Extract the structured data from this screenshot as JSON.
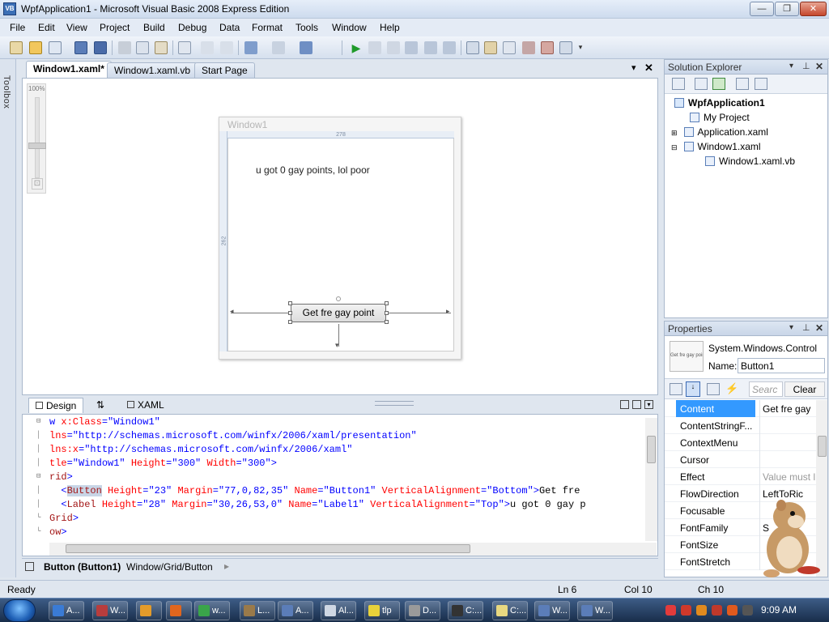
{
  "window": {
    "title": "WpfApplication1 - Microsoft Visual Basic 2008 Express Edition",
    "app_icon": "VB",
    "min_icon": "minimize-icon",
    "max_icon": "maximize-icon",
    "close_icon": "close-icon",
    "min_glyph": "—",
    "max_glyph": "❐",
    "close_glyph": "✕"
  },
  "menu": [
    "File",
    "Edit",
    "View",
    "Project",
    "Build",
    "Debug",
    "Data",
    "Format",
    "Tools",
    "Window",
    "Help"
  ],
  "toolbox": {
    "label": "Toolbox"
  },
  "doc_tabs": {
    "tabs": [
      "Window1.xaml*",
      "Window1.xaml.vb",
      "Start Page"
    ],
    "close_glyph": "✕",
    "dropdown_glyph": "▾"
  },
  "designer": {
    "zoom": "100%",
    "window_title": "Window1",
    "ruler_width": "278",
    "ruler_height": "262",
    "label_text": "u got 0 gay points, lol poor",
    "button_text": "Get fre gay point"
  },
  "view_tabs": {
    "design": "Design",
    "swap": "⇅",
    "xaml": "XAML"
  },
  "xaml_lines": [
    [
      {
        "t": "w ",
        "c": "pu"
      },
      {
        "t": "x:Class",
        "c": "at"
      },
      {
        "t": "=\"Window1\"",
        "c": "st"
      }
    ],
    [
      {
        "t": "lns",
        "c": "at"
      },
      {
        "t": "=\"http://schemas.microsoft.com/winfx/2006/xaml/presentation\"",
        "c": "st"
      }
    ],
    [
      {
        "t": "lns:x",
        "c": "at"
      },
      {
        "t": "=\"http://schemas.microsoft.com/winfx/2006/xaml\"",
        "c": "st"
      }
    ],
    [
      {
        "t": "tle",
        "c": "at"
      },
      {
        "t": "=\"Window1\"",
        "c": "st"
      },
      {
        "t": " Height",
        "c": "at"
      },
      {
        "t": "=\"300\"",
        "c": "st"
      },
      {
        "t": " Width",
        "c": "at"
      },
      {
        "t": "=\"300\">",
        "c": "st"
      }
    ],
    [
      {
        "t": "rid",
        "c": "kw"
      },
      {
        "t": ">",
        "c": "pu"
      }
    ],
    [
      {
        "t": "  <",
        "c": "pu"
      },
      {
        "t": "Button",
        "c": "kw"
      },
      {
        "t": " Height",
        "c": "at"
      },
      {
        "t": "=\"23\"",
        "c": "st"
      },
      {
        "t": " Margin",
        "c": "at"
      },
      {
        "t": "=\"77,0,82,35\"",
        "c": "st"
      },
      {
        "t": " Name",
        "c": "at"
      },
      {
        "t": "=\"Button1\"",
        "c": "st"
      },
      {
        "t": " VerticalAlignment",
        "c": "at"
      },
      {
        "t": "=\"Bottom\">",
        "c": "st"
      },
      {
        "t": "Get fre",
        "c": ""
      }
    ],
    [
      {
        "t": "  <",
        "c": "pu"
      },
      {
        "t": "Label",
        "c": "kw"
      },
      {
        "t": " Height",
        "c": "at"
      },
      {
        "t": "=\"28\"",
        "c": "st"
      },
      {
        "t": " Margin",
        "c": "at"
      },
      {
        "t": "=\"30,26,53,0\"",
        "c": "st"
      },
      {
        "t": " Name",
        "c": "at"
      },
      {
        "t": "=\"Label1\"",
        "c": "st"
      },
      {
        "t": " VerticalAlignment",
        "c": "at"
      },
      {
        "t": "=\"Top\">",
        "c": "st"
      },
      {
        "t": "u got 0 gay p",
        "c": ""
      }
    ],
    [
      {
        "t": "Grid",
        "c": "kw"
      },
      {
        "t": ">",
        "c": "pu"
      }
    ],
    [
      {
        "t": "ow",
        "c": "kw"
      },
      {
        "t": ">",
        "c": "pu"
      }
    ]
  ],
  "breadcrumb": {
    "element": "Button (Button1)",
    "path": "Window/Grid/Button"
  },
  "solution_explorer": {
    "title": "Solution Explorer",
    "items": [
      "WpfApplication1",
      "My Project",
      "Application.xaml",
      "Window1.xaml",
      "Window1.xaml.vb"
    ]
  },
  "properties": {
    "title": "Properties",
    "type": "System.Windows.Control",
    "name_label": "Name:",
    "name_value": "Button1",
    "search_placeholder": "Searc",
    "clear": "Clear",
    "preview": "Get fre gay point",
    "rows": [
      {
        "name": "Content",
        "value": "Get fre gay"
      },
      {
        "name": "ContentStringF...",
        "value": ""
      },
      {
        "name": "ContextMenu",
        "value": ""
      },
      {
        "name": "Cursor",
        "value": ""
      },
      {
        "name": "Effect",
        "value": "Value must l"
      },
      {
        "name": "FlowDirection",
        "value": "LeftToRic"
      },
      {
        "name": "Focusable",
        "value": ""
      },
      {
        "name": "FontFamily",
        "value": "S"
      },
      {
        "name": "FontSize",
        "value": ""
      },
      {
        "name": "FontStretch",
        "value": ""
      }
    ]
  },
  "status": {
    "state": "Ready",
    "ln": "Ln 6",
    "col": "Col 10",
    "ch": "Ch 10"
  },
  "taskbar": {
    "items": [
      "A...",
      "W...",
      "",
      "",
      "w...",
      "L...",
      "A...",
      "Al...",
      "tlp",
      "D...",
      "C:...",
      "C:...",
      "W...",
      "W..."
    ],
    "clock": "9:09 AM"
  }
}
